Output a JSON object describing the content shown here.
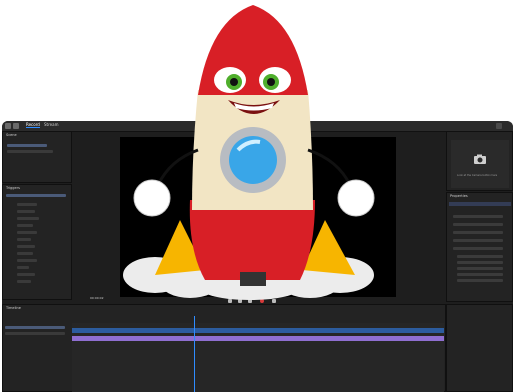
{
  "app": {
    "tabs": [
      {
        "label": "Record"
      },
      {
        "label": "Stream"
      }
    ],
    "panels": {
      "scene_title": "Scene",
      "triggers_title": "Triggers",
      "properties_title": "Properties",
      "camera_hint": "Look at the Camera button here",
      "timeline_title": "Timeline"
    },
    "timecode": "00:00:02"
  },
  "colors": {
    "accent": "#2f8cff",
    "track_blue": "#2c5c9e",
    "track_purple": "#8f6fd1",
    "panel_bg": "#232323",
    "rocket_red": "#d81f26",
    "rocket_cream": "#f2e5c4"
  }
}
